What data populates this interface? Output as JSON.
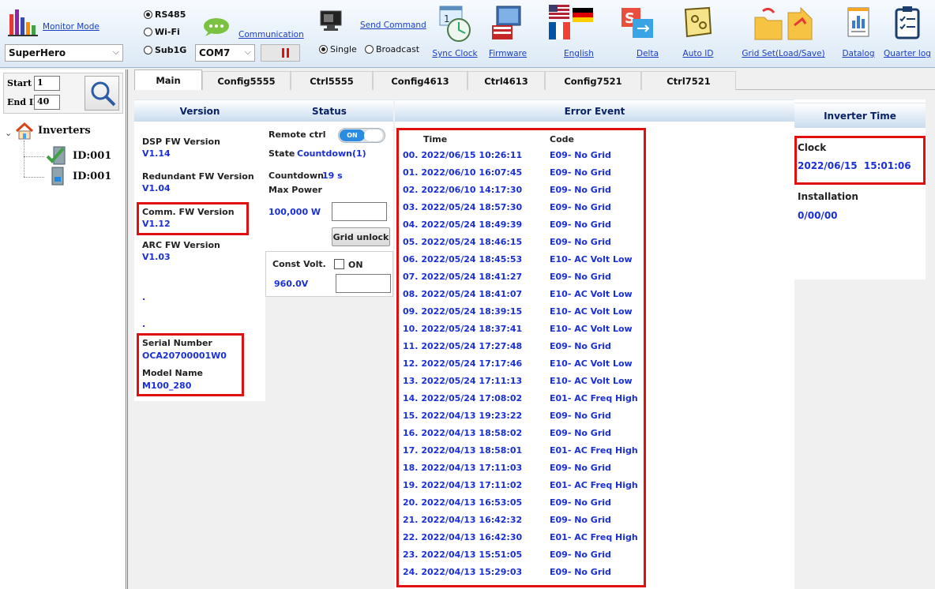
{
  "toolbar": {
    "monitor_mode": "Monitor Mode",
    "hero_select": "SuperHero",
    "radios": [
      "RS485",
      "Wi-Fi",
      "Sub1G"
    ],
    "com_port": "COM7",
    "communication": "Communication",
    "send_command": "Send Command",
    "single": "Single",
    "broadcast": "Broadcast",
    "sync_clock": "Sync Clock",
    "firmware": "Firmware",
    "english": "English",
    "delta": "Delta",
    "auto_id": "Auto ID",
    "grid_set": "Grid Set(Load/Save)",
    "datalog": "Datalog",
    "quarter_log": "Quarter log"
  },
  "left": {
    "start_id_label": "Start ID",
    "start_id": "1",
    "end_id_label": "End ID",
    "end_id": "40",
    "tree_root": "Inverters",
    "tree_items": [
      "ID:001",
      "ID:001"
    ]
  },
  "tabs": [
    "Main",
    "Config5555",
    "Ctrl5555",
    "Config4613",
    "Ctrl4613",
    "Config7521",
    "Ctrl7521"
  ],
  "version": {
    "header": "Version",
    "dsp_label": "DSP FW Version",
    "dsp_value": "V1.14",
    "redundant_label": "Redundant FW Version",
    "redundant_value": "V1.04",
    "comm_label": "Comm. FW Version",
    "comm_value": "V1.12",
    "arc_label": "ARC FW Version",
    "arc_value": "V1.03",
    "dot1": ".",
    "dot2": ".",
    "serial_label": "Serial Number",
    "serial_value": "OCA20700001W0",
    "model_label": "Model Name",
    "model_value": "M100_280"
  },
  "status": {
    "header": "Status",
    "remote_ctrl": "Remote ctrl",
    "toggle_on": "ON",
    "state_label": "State",
    "state_value": "Countdown(1)",
    "countdown_label": "Countdown",
    "countdown_value": "19 s",
    "max_power_label": "Max Power",
    "max_power_value": "100,000 W",
    "grid_unlock": "Grid unlock",
    "const_volt_label": "Const Volt.",
    "const_volt_on": "ON",
    "const_volt_value": "960.0V"
  },
  "error_event": {
    "header": "Error Event",
    "col_time": "Time",
    "col_code": "Code",
    "rows": [
      {
        "time": "00. 2022/06/15 10:26:11",
        "code": "E09- No Grid"
      },
      {
        "time": "01. 2022/06/10 16:07:45",
        "code": "E09- No Grid"
      },
      {
        "time": "02. 2022/06/10 14:17:30",
        "code": "E09- No Grid"
      },
      {
        "time": "03. 2022/05/24 18:57:30",
        "code": "E09- No Grid"
      },
      {
        "time": "04. 2022/05/24 18:49:39",
        "code": "E09- No Grid"
      },
      {
        "time": "05. 2022/05/24 18:46:15",
        "code": "E09- No Grid"
      },
      {
        "time": "06. 2022/05/24 18:45:53",
        "code": "E10- AC Volt Low"
      },
      {
        "time": "07. 2022/05/24 18:41:27",
        "code": "E09- No Grid"
      },
      {
        "time": "08. 2022/05/24 18:41:07",
        "code": "E10- AC Volt Low"
      },
      {
        "time": "09. 2022/05/24 18:39:15",
        "code": "E10- AC Volt Low"
      },
      {
        "time": "10. 2022/05/24 18:37:41",
        "code": "E10- AC Volt Low"
      },
      {
        "time": "11. 2022/05/24 17:27:48",
        "code": "E09- No Grid"
      },
      {
        "time": "12. 2022/05/24 17:17:46",
        "code": "E10- AC Volt Low"
      },
      {
        "time": "13. 2022/05/24 17:11:13",
        "code": "E10- AC Volt Low"
      },
      {
        "time": "14. 2022/05/24 17:08:02",
        "code": "E01- AC Freq High"
      },
      {
        "time": "15. 2022/04/13 19:23:22",
        "code": "E09- No Grid"
      },
      {
        "time": "16. 2022/04/13 18:58:02",
        "code": "E09- No Grid"
      },
      {
        "time": "17. 2022/04/13 18:58:01",
        "code": "E01- AC Freq High"
      },
      {
        "time": "18. 2022/04/13 17:11:03",
        "code": "E09- No Grid"
      },
      {
        "time": "19. 2022/04/13 17:11:02",
        "code": "E01- AC Freq High"
      },
      {
        "time": "20. 2022/04/13 16:53:05",
        "code": "E09- No Grid"
      },
      {
        "time": "21. 2022/04/13 16:42:32",
        "code": "E09- No Grid"
      },
      {
        "time": "22. 2022/04/13 16:42:30",
        "code": "E01- AC Freq High"
      },
      {
        "time": "23. 2022/04/13 15:51:05",
        "code": "E09- No Grid"
      },
      {
        "time": "24. 2022/04/13 15:29:03",
        "code": "E09- No Grid"
      }
    ]
  },
  "inverter_time": {
    "header": "Inverter Time",
    "clock_label": "Clock",
    "clock_value": "2022/06/15  15:01:06",
    "installation_label": "Installation",
    "installation_value": "0/00/00"
  },
  "colors": {
    "value_blue": "#1a2fd6",
    "highlight_red": "#e01010",
    "header_navy": "#0a2366",
    "toggle_blue": "#2b8be0"
  }
}
